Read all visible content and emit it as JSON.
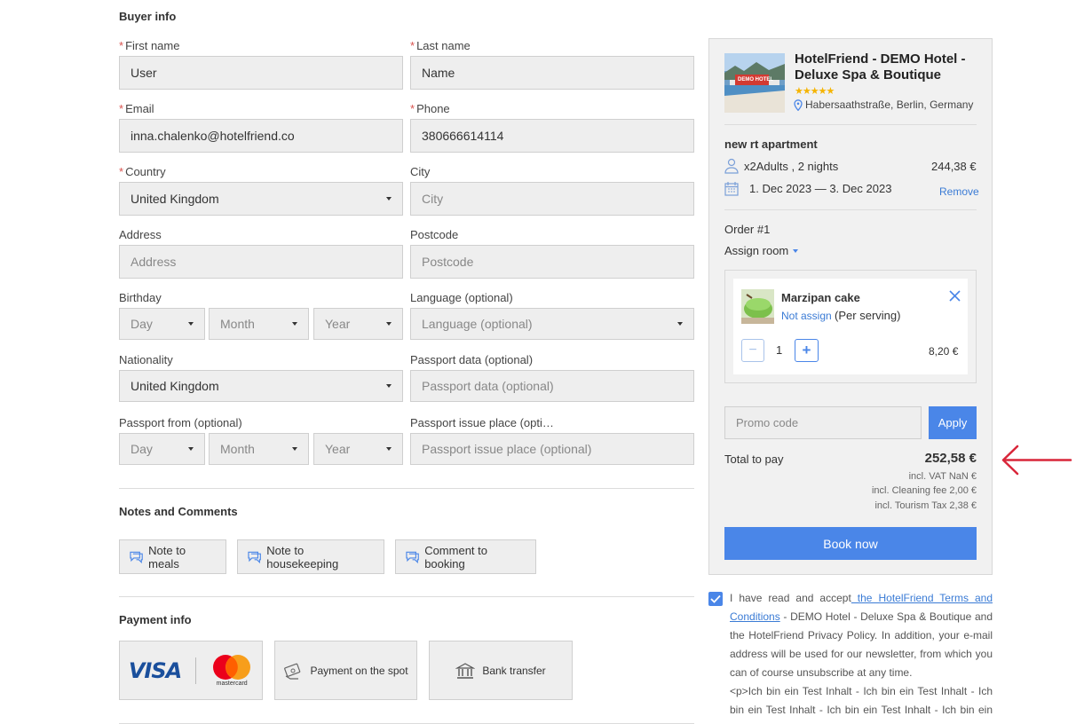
{
  "buyer": {
    "title": "Buyer info",
    "first_name": {
      "label": "First name",
      "value": "User"
    },
    "last_name": {
      "label": "Last name",
      "value": "Name"
    },
    "email": {
      "label": "Email",
      "value": "inna.chalenko@hotelfriend.co"
    },
    "phone": {
      "label": "Phone",
      "value": "380666614114"
    },
    "country": {
      "label": "Country",
      "value": "United Kingdom"
    },
    "city": {
      "label": "City",
      "placeholder": "City"
    },
    "address": {
      "label": "Address",
      "placeholder": "Address"
    },
    "postcode": {
      "label": "Postcode",
      "placeholder": "Postcode"
    },
    "birthday": {
      "label": "Birthday",
      "day": "Day",
      "month": "Month",
      "year": "Year"
    },
    "language": {
      "label": "Language (optional)",
      "placeholder": "Language (optional)"
    },
    "nationality": {
      "label": "Nationality",
      "value": "United Kingdom"
    },
    "passport_data": {
      "label": "Passport data (optional)",
      "placeholder": "Passport data (optional)"
    },
    "passport_from": {
      "label": "Passport from (optional)",
      "day": "Day",
      "month": "Month",
      "year": "Year"
    },
    "passport_issue": {
      "label": "Passport issue place (opti…",
      "placeholder": "Passport issue place (optional)"
    }
  },
  "notes": {
    "title": "Notes and Comments",
    "meals": "Note to meals",
    "housekeeping": "Note to housekeeping",
    "booking": "Comment to booking"
  },
  "payment": {
    "title": "Payment info",
    "visa": "VISA",
    "mastercard": "mastercard",
    "spot": "Payment on the spot",
    "bank": "Bank transfer"
  },
  "hotel": {
    "name": "HotelFriend - DEMO Hotel - Deluxe Spa & Boutique",
    "stars": "★★★★★",
    "address": "Habersaathstraße, Berlin, Germany",
    "image_sign": "DEMO HOTEL"
  },
  "booking": {
    "room": "new rt apartment",
    "guests": "x2Adults , 2 nights",
    "price": "244,38 €",
    "dates": "1. Dec 2023 — 3. Dec 2023",
    "remove": "Remove",
    "order": "Order #1",
    "assign_room": "Assign room"
  },
  "extra": {
    "name": "Marzipan cake",
    "not_assign": "Not assign",
    "per": "(Per serving)",
    "qty": "1",
    "price": "8,20 €"
  },
  "promo": {
    "placeholder": "Promo code",
    "apply": "Apply"
  },
  "total": {
    "label": "Total to pay",
    "amount": "252,58 €",
    "vat": "incl. VAT NaN €",
    "cleaning": "incl. Cleaning fee 2,00 €",
    "tourism": "incl. Tourism Tax 2,38 €"
  },
  "book_now": "Book now",
  "terms": {
    "pre": "I have read and accept",
    "link": " the HotelFriend Terms and Conditions",
    "post": " - DEMO Hotel - Deluxe Spa & Boutique and the HotelFriend Privacy Policy. In addition, your e-mail address will be used for our newsletter, from which you can of course unsubscribe at any time.",
    "extra": "<p>Ich bin ein Test Inhalt - Ich bin ein Test Inhalt - Ich bin ein Test Inhalt - Ich bin ein Test Inhalt - Ich bin ein Test"
  },
  "colors": {
    "accent": "#4a86e8",
    "required": "#d9534f",
    "arrow": "#d9263a",
    "stars": "#f5b400"
  }
}
